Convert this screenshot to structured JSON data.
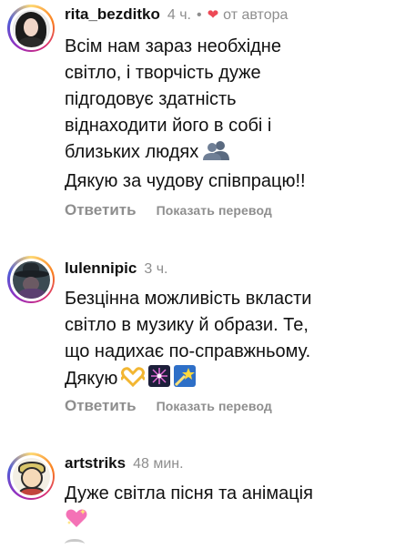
{
  "comments": [
    {
      "username": "rita_bezditko",
      "time": "4 ч.",
      "author_label": "от автора",
      "text_lines": [
        "Всім нам зараз необхідне",
        "світло, і творчість дуже",
        "підгодовує здатність",
        "віднаходити його в собі і",
        "близьких людях"
      ],
      "text_extra": "Дякую за чудову співпрацю!!",
      "reply": "Ответить",
      "translate": "Показать перевод",
      "emojis": [
        "people-silhouettes-emoji"
      ]
    },
    {
      "username": "lulennipic",
      "time": "3 ч.",
      "text_lines": [
        "Безцінна можливість вкласти",
        "світло в музику й образи. Те,",
        "що надихає по-справжньому."
      ],
      "text_extra": "Дякую",
      "reply": "Ответить",
      "translate": "Показать перевод",
      "emojis": [
        "heart-hands-emoji",
        "fireworks-emoji",
        "shooting-star-emoji"
      ]
    },
    {
      "username": "artstriks",
      "time": "48 мин.",
      "text_lines": [
        "Дуже світла пісня та анімація"
      ],
      "emojis": [
        "sparkling-heart-emoji"
      ]
    }
  ],
  "colors": {
    "heart": "#ed4956",
    "muted": "#8e8e8e",
    "text": "#111111"
  }
}
